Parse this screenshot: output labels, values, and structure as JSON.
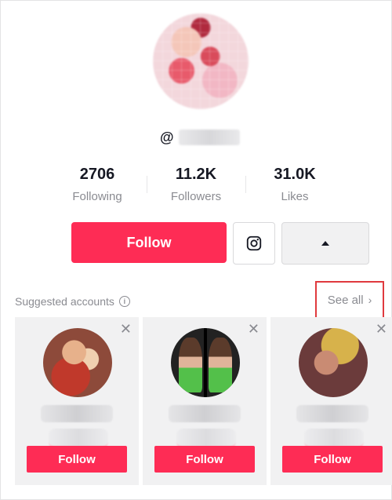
{
  "profile": {
    "handle_prefix": "@",
    "handle_hidden": ""
  },
  "stats": [
    {
      "value": "2706",
      "label": "Following"
    },
    {
      "value": "11.2K",
      "label": "Followers"
    },
    {
      "value": "31.0K",
      "label": "Likes"
    }
  ],
  "actions": {
    "follow_label": "Follow",
    "instagram_icon": "instagram-icon",
    "more_icon": "triangle-up-icon"
  },
  "suggested": {
    "title": "Suggested accounts",
    "see_all_label": "See all",
    "see_all_icon": "chevron-right-icon",
    "cards": [
      {
        "follow_label": "Follow"
      },
      {
        "follow_label": "Follow"
      },
      {
        "follow_label": "Follow"
      }
    ]
  },
  "colors": {
    "brand": "#fe2c55",
    "highlight": "#e03a3e",
    "muted_text": "#8a8b91"
  }
}
